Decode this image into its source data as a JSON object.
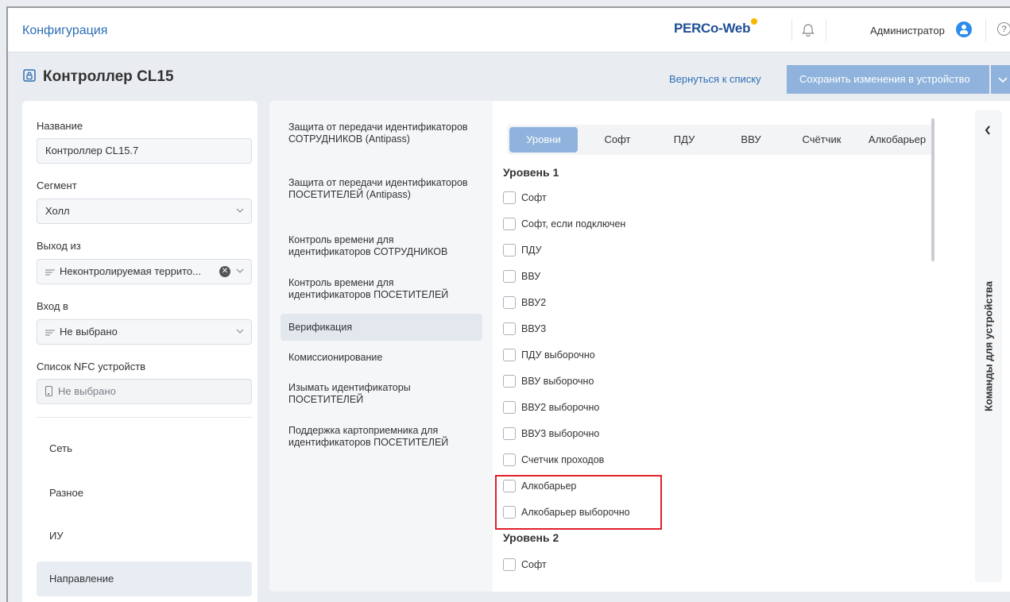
{
  "header": {
    "section_title": "Конфигурация",
    "logo": "PERCo-Web",
    "user_name": "Администратор",
    "help_glyph": "?"
  },
  "page": {
    "title": "Контроллер CL15",
    "back_link": "Вернуться к списку",
    "save_button": "Сохранить изменения в устройство"
  },
  "form": {
    "name_label": "Название",
    "name_value": "Контроллер CL15.7",
    "segment_label": "Сегмент",
    "segment_value": "Холл",
    "exit_label": "Выход из",
    "exit_value": "Неконтролируемая террито...",
    "entry_label": "Вход в",
    "entry_value": "Не выбрано",
    "nfc_label": "Список NFC устройств",
    "nfc_value": "Не выбрано"
  },
  "left_nav": [
    {
      "label": "Сеть"
    },
    {
      "label": "Разное"
    },
    {
      "label": "ИУ"
    },
    {
      "label": "Направление"
    }
  ],
  "menu": [
    {
      "label": "Защита от передачи идентификаторов СОТРУДНИКОВ (Antipass)"
    },
    {
      "label": "Защита от передачи идентификаторов ПОСЕТИТЕЛЕЙ (Antipass)"
    },
    {
      "label": "Контроль времени для идентификаторов СОТРУДНИКОВ"
    },
    {
      "label": "Контроль времени для идентификаторов ПОСЕТИТЕЛЕЙ"
    },
    {
      "label": "Верификация"
    },
    {
      "label": "Комиссионирование"
    },
    {
      "label": "Изымать идентификаторы ПОСЕТИТЕЛЕЙ"
    },
    {
      "label": "Поддержка картоприемника для идентификаторов ПОСЕТИТЕЛЕЙ"
    }
  ],
  "tabs": [
    {
      "label": "Уровни"
    },
    {
      "label": "Софт"
    },
    {
      "label": "ПДУ"
    },
    {
      "label": "ВВУ"
    },
    {
      "label": "Счётчик"
    },
    {
      "label": "Алкобарьер"
    }
  ],
  "levels": {
    "level1_title": "Уровень 1",
    "level1_items": [
      {
        "label": "Софт",
        "checked": false
      },
      {
        "label": "Софт, если подключен",
        "checked": false
      },
      {
        "label": "ПДУ",
        "checked": false
      },
      {
        "label": "ВВУ",
        "checked": false
      },
      {
        "label": "ВВУ2",
        "checked": false
      },
      {
        "label": "ВВУ3",
        "checked": false
      },
      {
        "label": "ПДУ выборочно",
        "checked": false
      },
      {
        "label": "ВВУ выборочно",
        "checked": false
      },
      {
        "label": "ВВУ2 выборочно",
        "checked": false
      },
      {
        "label": "ВВУ3 выборочно",
        "checked": false
      },
      {
        "label": "Счетчик проходов",
        "checked": false
      },
      {
        "label": "Алкобарьер",
        "checked": false
      },
      {
        "label": "Алкобарьер выборочно",
        "checked": false
      }
    ],
    "level2_title": "Уровень 2",
    "level2_items": [
      {
        "label": "Софт",
        "checked": false
      }
    ]
  },
  "side_panel": {
    "label": "Команды для устройства"
  },
  "colors": {
    "accent": "#2d6fb5",
    "button": "#8fb3dc",
    "highlight": "#e0202a"
  }
}
